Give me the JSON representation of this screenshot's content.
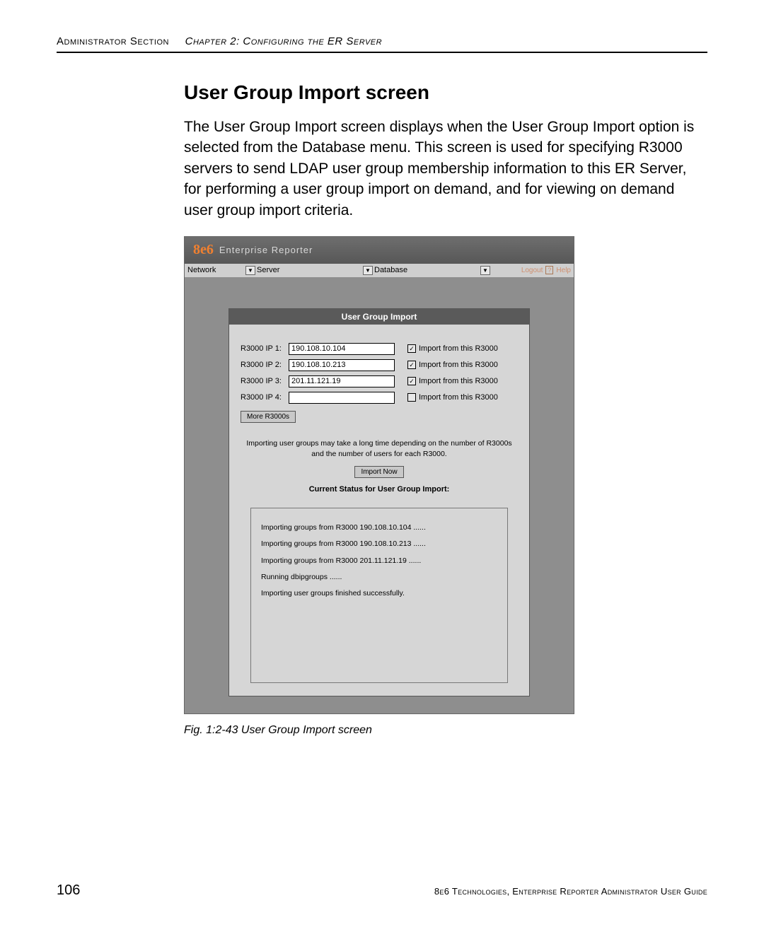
{
  "header": {
    "section": "Administrator Section",
    "chapter": "Chapter 2: Configuring the ER Server"
  },
  "section_title": "User Group Import screen",
  "body_paragraph": "The User Group Import screen displays when the User Group Import option is selected from the Database menu. This screen is used for specifying R3000 servers to send LDAP user group membership information to this ER Server, for performing a user group import on demand, and for viewing on demand user group import criteria.",
  "app": {
    "logo_prefix": "8e6",
    "logo_text": "Enterprise Reporter",
    "menus": {
      "network": "Network",
      "server": "Server",
      "database": "Database",
      "logout": "Logout",
      "help_badge": "?",
      "help": "Help"
    },
    "panel_title": "User Group Import",
    "rows": [
      {
        "label": "R3000 IP 1:",
        "value": "190.108.10.104",
        "checked": true,
        "import_label": "Import from this R3000"
      },
      {
        "label": "R3000 IP 2:",
        "value": "190.108.10.213",
        "checked": true,
        "import_label": "Import from this R3000"
      },
      {
        "label": "R3000 IP 3:",
        "value": "201.11.121.19",
        "checked": true,
        "import_label": "Import from this R3000"
      },
      {
        "label": "R3000 IP 4:",
        "value": "",
        "checked": false,
        "import_label": "Import from this R3000"
      }
    ],
    "more_button": "More R3000s",
    "note": "Importing user groups may take a long time depending on the number of R3000s and the number of users for each R3000.",
    "import_button": "Import Now",
    "status_title": "Current Status for User Group Import:",
    "status_lines": [
      "Importing groups from R3000 190.108.10.104 ......",
      "Importing groups from R3000 190.108.10.213 ......",
      "Importing groups from R3000 201.11.121.19 ......",
      "Running dbipgroups ......",
      "Importing user groups finished successfully."
    ]
  },
  "figure_caption": "Fig. 1:2-43  User Group Import screen",
  "footer": {
    "page": "106",
    "text": "8e6 Technologies, Enterprise Reporter Administrator User Guide"
  }
}
